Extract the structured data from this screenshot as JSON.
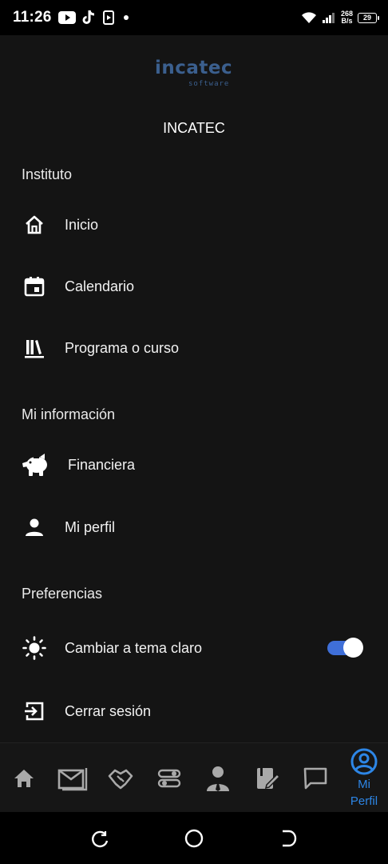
{
  "status_bar": {
    "time": "11:26",
    "net_speed_value": "268",
    "net_speed_unit": "B/s",
    "battery": "29"
  },
  "drawer": {
    "logo_text": "incatec",
    "logo_sub": "software",
    "org_name": "INCATEC",
    "sections": [
      {
        "title": "Instituto",
        "items": [
          {
            "label": "Inicio",
            "icon": "home-icon"
          },
          {
            "label": "Calendario",
            "icon": "calendar-icon"
          },
          {
            "label": "Programa o curso",
            "icon": "books-icon"
          }
        ]
      },
      {
        "title": "Mi información",
        "items": [
          {
            "label": "Financiera",
            "icon": "piggy-bank-icon"
          },
          {
            "label": "Mi perfil",
            "icon": "person-icon"
          }
        ]
      },
      {
        "title": "Preferencias",
        "items": [
          {
            "label": "Cambiar a tema claro",
            "icon": "sun-icon",
            "toggle_on": true
          },
          {
            "label": "Cerrar sesión",
            "icon": "logout-icon"
          }
        ]
      }
    ]
  },
  "bottom_nav": {
    "items": [
      {
        "icon": "home-icon"
      },
      {
        "icon": "mail-icon"
      },
      {
        "icon": "handshake-icon"
      },
      {
        "icon": "route-icon"
      },
      {
        "icon": "teacher-icon"
      },
      {
        "icon": "assignment-icon"
      },
      {
        "icon": "chat-icon"
      },
      {
        "icon": "account-circle-icon",
        "label": "Mi Perfil",
        "active": true
      }
    ]
  },
  "colors": {
    "background": "#141414",
    "accent": "#2d86e6",
    "toggle": "#3f6fd8",
    "logo": "#3b5f8e"
  }
}
